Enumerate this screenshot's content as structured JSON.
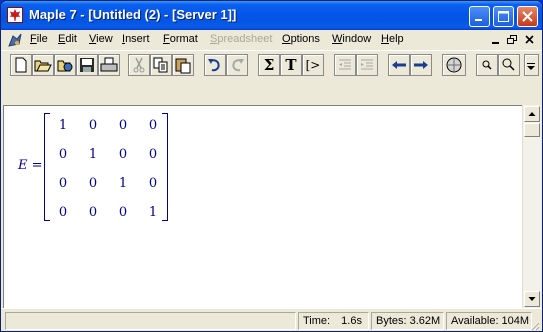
{
  "window": {
    "title": "Maple 7  - [Untitled (2) - [Server 1]]",
    "buttons": [
      "minimize",
      "maximize",
      "close"
    ]
  },
  "menubar": {
    "items": [
      {
        "label": "File",
        "enabled": true
      },
      {
        "label": "Edit",
        "enabled": true
      },
      {
        "label": "View",
        "enabled": true
      },
      {
        "label": "Insert",
        "enabled": true
      },
      {
        "label": "Format",
        "enabled": true
      },
      {
        "label": "Spreadsheet",
        "enabled": false
      },
      {
        "label": "Options",
        "enabled": true
      },
      {
        "label": "Window",
        "enabled": true
      },
      {
        "label": "Help",
        "enabled": true
      }
    ]
  },
  "toolbar": {
    "buttons": [
      {
        "name": "new-icon"
      },
      {
        "name": "open-icon"
      },
      {
        "name": "open-url-icon"
      },
      {
        "name": "save-icon"
      },
      {
        "name": "print-icon"
      },
      {
        "name": "cut-icon",
        "enabled": false
      },
      {
        "name": "copy-icon"
      },
      {
        "name": "paste-icon"
      },
      {
        "name": "undo-icon"
      },
      {
        "name": "redo-icon",
        "enabled": false
      },
      {
        "name": "math-input-icon",
        "glyph": "Σ"
      },
      {
        "name": "text-input-icon",
        "glyph": "T"
      },
      {
        "name": "execution-group-icon",
        "glyph": "[>"
      },
      {
        "name": "outdent-icon",
        "enabled": false
      },
      {
        "name": "indent-icon",
        "enabled": false
      },
      {
        "name": "back-icon"
      },
      {
        "name": "forward-icon"
      },
      {
        "name": "stop-icon"
      },
      {
        "name": "zoom-in-icon"
      },
      {
        "name": "zoom-out-icon"
      }
    ]
  },
  "document": {
    "lhs_var": "E",
    "equals": "=",
    "matrix": [
      [
        "1",
        "0",
        "0",
        "0"
      ],
      [
        "0",
        "1",
        "0",
        "0"
      ],
      [
        "0",
        "0",
        "1",
        "0"
      ],
      [
        "0",
        "0",
        "0",
        "1"
      ]
    ]
  },
  "statusbar": {
    "time_label": "Time:",
    "time_value": "1.6s",
    "bytes": "Bytes: 3.62M",
    "available": "Available: 104M"
  },
  "colors": {
    "title_bar": "#0355e4",
    "math_output": "#000080",
    "chrome": "#ece9d8"
  }
}
